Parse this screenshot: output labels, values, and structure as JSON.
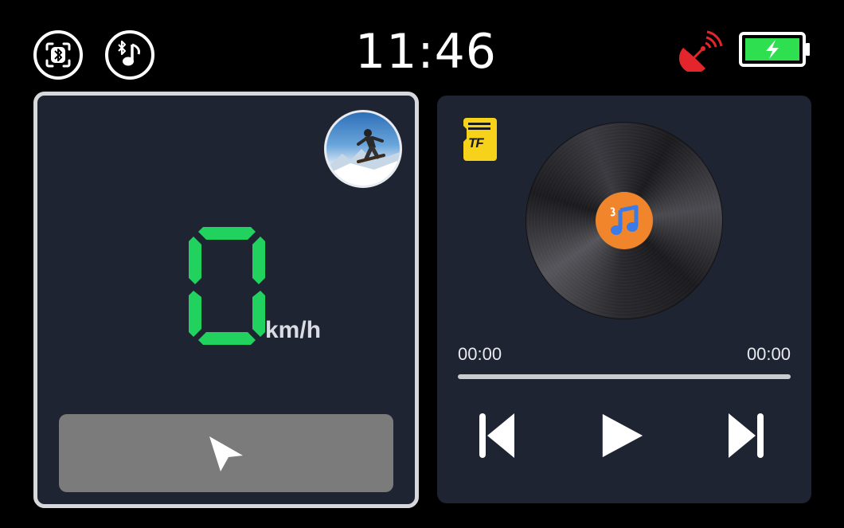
{
  "status_bar": {
    "time": "11:46",
    "icons": [
      "bluetooth-screen-icon",
      "bluetooth-music-icon",
      "satellite-signal-icon",
      "battery-charging-icon"
    ],
    "colors": {
      "satellite": "#e4252b",
      "battery": "#2ee04f"
    }
  },
  "speedometer": {
    "speed": "0",
    "unit": "km/h",
    "digit_color": "#22d25f"
  },
  "navigation": {
    "icon": "navigation-arrow-icon"
  },
  "music": {
    "source_label": "TF",
    "elapsed": "00:00",
    "total": "00:00",
    "progress": 0,
    "controls": [
      "previous-icon",
      "play-icon",
      "next-icon"
    ]
  },
  "colors": {
    "panel_bg": "#1e2431",
    "nav_button": "#7b7b7b",
    "tf_card": "#f6d21a",
    "vinyl_label": "#f0852b"
  }
}
